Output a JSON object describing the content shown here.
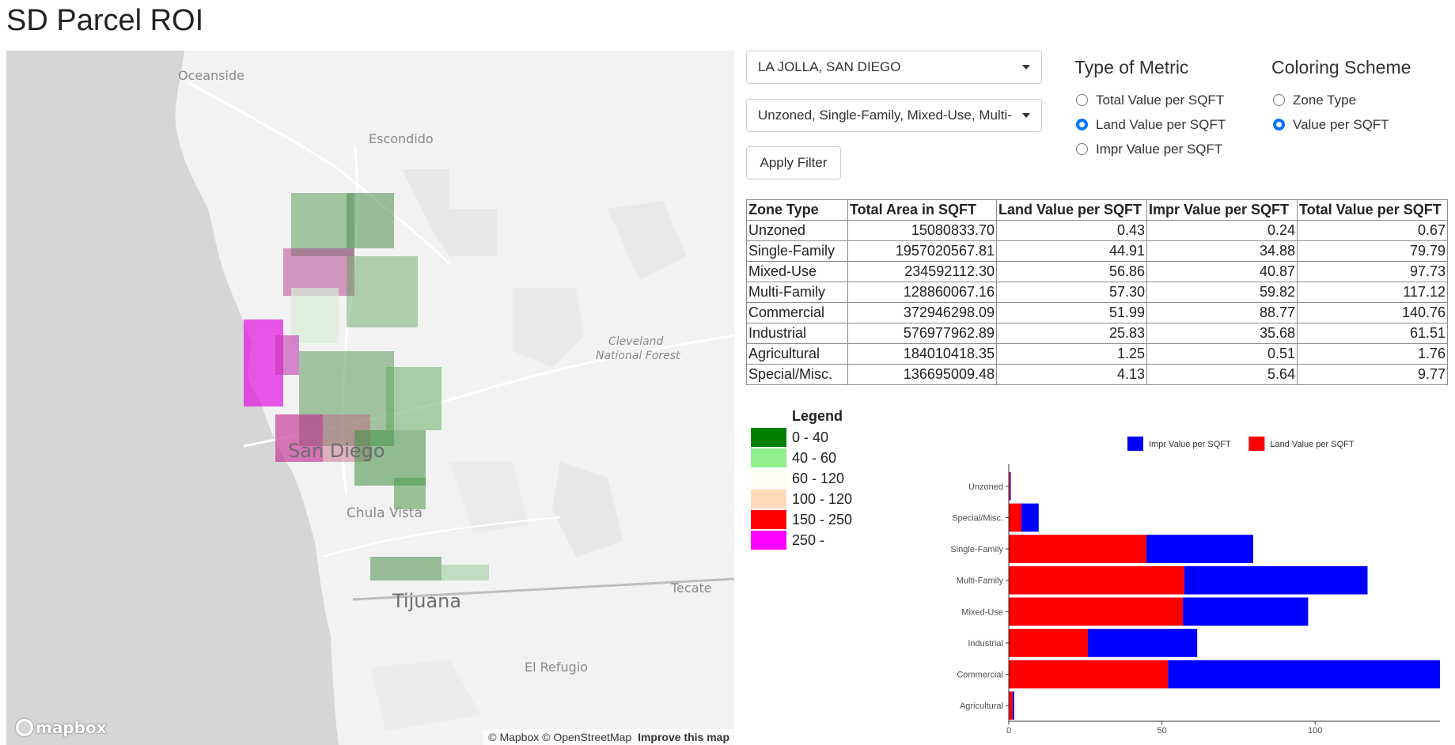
{
  "page": {
    "title": "SD Parcel ROI"
  },
  "map": {
    "labels": {
      "oceanside": "Oceanside",
      "escondido": "Escondido",
      "cleveland": "Cleveland",
      "national_forest": "National Forest",
      "san_diego": "San Diego",
      "chula_vista": "Chula Vista",
      "tijuana": "Tijuana",
      "tecate": "Tecate",
      "el_refugio": "El Refugio"
    },
    "logo": "mapbox",
    "attribution": "© Mapbox © OpenStreetMap",
    "improve": "Improve this map"
  },
  "filters": {
    "location": "LA JOLLA, SAN DIEGO",
    "zones": "Unzoned, Single-Family, Mixed-Use, Multi-",
    "apply_label": "Apply Filter"
  },
  "metric": {
    "title": "Type of Metric",
    "options": [
      {
        "label": "Total Value per SQFT",
        "selected": false
      },
      {
        "label": "Land Value per SQFT",
        "selected": true
      },
      {
        "label": "Impr Value per SQFT",
        "selected": false
      }
    ]
  },
  "coloring": {
    "title": "Coloring Scheme",
    "options": [
      {
        "label": "Zone Type",
        "selected": false
      },
      {
        "label": "Value per SQFT",
        "selected": true
      }
    ]
  },
  "table": {
    "headers": [
      "Zone Type",
      "Total Area in SQFT",
      "Land Value per SQFT",
      "Impr Value per SQFT",
      "Total Value per SQFT"
    ],
    "rows": [
      [
        "Unzoned",
        "15080833.70",
        "0.43",
        "0.24",
        "0.67"
      ],
      [
        "Single-Family",
        "1957020567.81",
        "44.91",
        "34.88",
        "79.79"
      ],
      [
        "Mixed-Use",
        "234592112.30",
        "56.86",
        "40.87",
        "97.73"
      ],
      [
        "Multi-Family",
        "128860067.16",
        "57.30",
        "59.82",
        "117.12"
      ],
      [
        "Commercial",
        "372946298.09",
        "51.99",
        "88.77",
        "140.76"
      ],
      [
        "Industrial",
        "576977962.89",
        "25.83",
        "35.68",
        "61.51"
      ],
      [
        "Agricultural",
        "184010418.35",
        "1.25",
        "0.51",
        "1.76"
      ],
      [
        "Special/Misc.",
        "136695009.48",
        "4.13",
        "5.64",
        "9.77"
      ]
    ]
  },
  "legend": {
    "title": "Legend",
    "items": [
      {
        "label": "0 - 40",
        "color": "#008000"
      },
      {
        "label": "40 - 60",
        "color": "#90ee90"
      },
      {
        "label": "60 - 120",
        "color": "#fffff0"
      },
      {
        "label": "100 - 120",
        "color": "#ffdab9"
      },
      {
        "label": "150 - 250",
        "color": "#ff0000"
      },
      {
        "label": "250 -",
        "color": "#ff00ff"
      }
    ]
  },
  "chart_data": {
    "type": "bar",
    "orientation": "horizontal",
    "stacked": true,
    "categories": [
      "Unzoned",
      "Special/Misc.",
      "Single-Family",
      "Multi-Family",
      "Mixed-Use",
      "Industrial",
      "Commercial",
      "Agricultural"
    ],
    "series": [
      {
        "name": "Land Value per SQFT",
        "color": "#ff0000",
        "values": [
          0.43,
          4.13,
          44.91,
          57.3,
          56.86,
          25.83,
          51.99,
          1.25
        ]
      },
      {
        "name": "Impr Value per SQFT",
        "color": "#0000ff",
        "values": [
          0.24,
          5.64,
          34.88,
          59.82,
          40.87,
          35.68,
          88.77,
          0.51
        ]
      }
    ],
    "xticks": [
      "0",
      "50",
      "100"
    ],
    "xlim": [
      0,
      140.76
    ],
    "legend_position": "top",
    "legend_order": [
      "Impr Value per SQFT",
      "Land Value per SQFT"
    ]
  }
}
